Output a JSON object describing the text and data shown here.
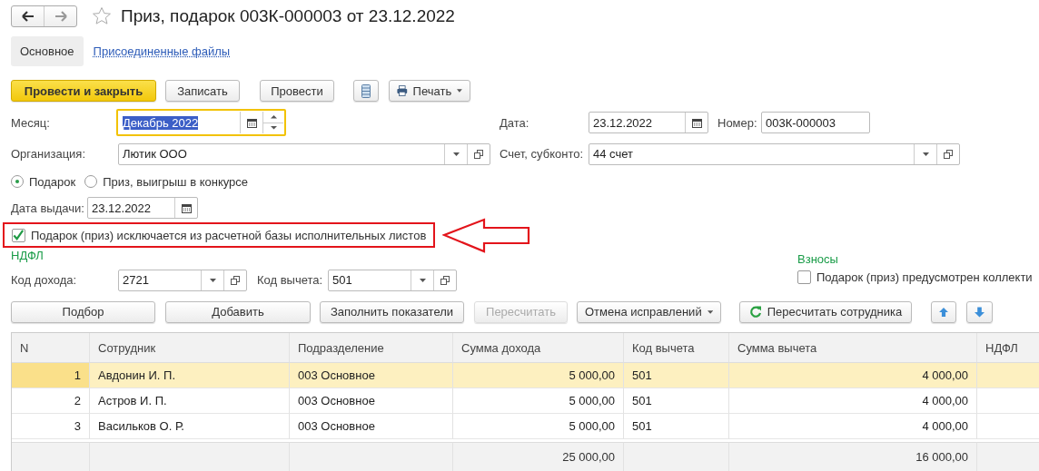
{
  "window": {
    "title": "Приз, подарок 003К-000003 от 23.12.2022",
    "favorite": false
  },
  "tabs": [
    {
      "label": "Основное",
      "selected": true
    },
    {
      "label": "Присоединенные файлы",
      "selected": false
    }
  ],
  "toolbar": [
    {
      "kind": "primary",
      "label": "Провести и закрыть"
    },
    {
      "kind": "button",
      "label": "Записать"
    },
    {
      "kind": "button",
      "label": "Провести"
    },
    {
      "kind": "list"
    },
    {
      "kind": "print",
      "label": "Печать"
    }
  ],
  "month": {
    "label": "Месяц:",
    "value": "Декабрь 2022",
    "focused": true,
    "text_selected": true
  },
  "date": {
    "label": "Дата:",
    "value": "23.12.2022"
  },
  "number": {
    "label": "Номер:",
    "value": "003К-000003"
  },
  "organization": {
    "label": "Организация:",
    "value": "Лютик ООО"
  },
  "account": {
    "label": "Счет, субконто:",
    "value": "44 счет"
  },
  "gift_type": [
    {
      "label": "Подарок",
      "selected": true
    },
    {
      "label": "Приз, выигрыш в конкурсе",
      "selected": false
    }
  ],
  "issue_date": {
    "label": "Дата выдачи:",
    "value": "23.12.2022"
  },
  "exclude_checkbox": {
    "label": "Подарок (приз) исключается из расчетной базы исполнительных листов",
    "checked": true,
    "highlighted": true
  },
  "ndfl": {
    "heading": "НДФЛ",
    "income_code": {
      "label": "Код дохода:",
      "value": "2721"
    },
    "deduction_code": {
      "label": "Код вычета:",
      "value": "501"
    }
  },
  "contributions": {
    "heading": "Взносы",
    "checkbox": {
      "label": "Подарок (приз) предусмотрен коллекти",
      "checked": false
    }
  },
  "table_buttons": [
    {
      "kind": "button",
      "label": "Подбор",
      "disabled": false
    },
    {
      "kind": "button",
      "label": "Добавить",
      "disabled": false
    },
    {
      "kind": "button",
      "label": "Заполнить показатели",
      "disabled": false
    },
    {
      "kind": "button",
      "label": "Пересчитать",
      "disabled": true
    },
    {
      "kind": "menu",
      "label": "Отмена исправлений",
      "disabled": false
    },
    {
      "kind": "refresh",
      "label": "Пересчитать сотрудника",
      "disabled": false
    },
    {
      "kind": "up",
      "disabled": false
    },
    {
      "kind": "down",
      "disabled": false
    }
  ],
  "table": {
    "columns": [
      {
        "title": "N"
      },
      {
        "title": "Сотрудник"
      },
      {
        "title": "Подразделение"
      },
      {
        "title": "Сумма дохода",
        "total": "25 000,00"
      },
      {
        "title": "Код вычета"
      },
      {
        "title": "Сумма вычета",
        "total": "16 000,00"
      },
      {
        "title": "НДФЛ"
      }
    ],
    "rows": [
      {
        "selected": true,
        "cells": [
          "1",
          "Авдонин И. П.",
          "003 Основное",
          "5 000,00",
          "501",
          "4 000,00"
        ]
      },
      {
        "selected": false,
        "cells": [
          "2",
          "Астров И. П.",
          "003 Основное",
          "5 000,00",
          "501",
          "4 000,00"
        ]
      },
      {
        "selected": false,
        "cells": [
          "3",
          "Васильков О. Р.",
          "003 Основное",
          "5 000,00",
          "501",
          "4 000,00"
        ]
      }
    ]
  }
}
